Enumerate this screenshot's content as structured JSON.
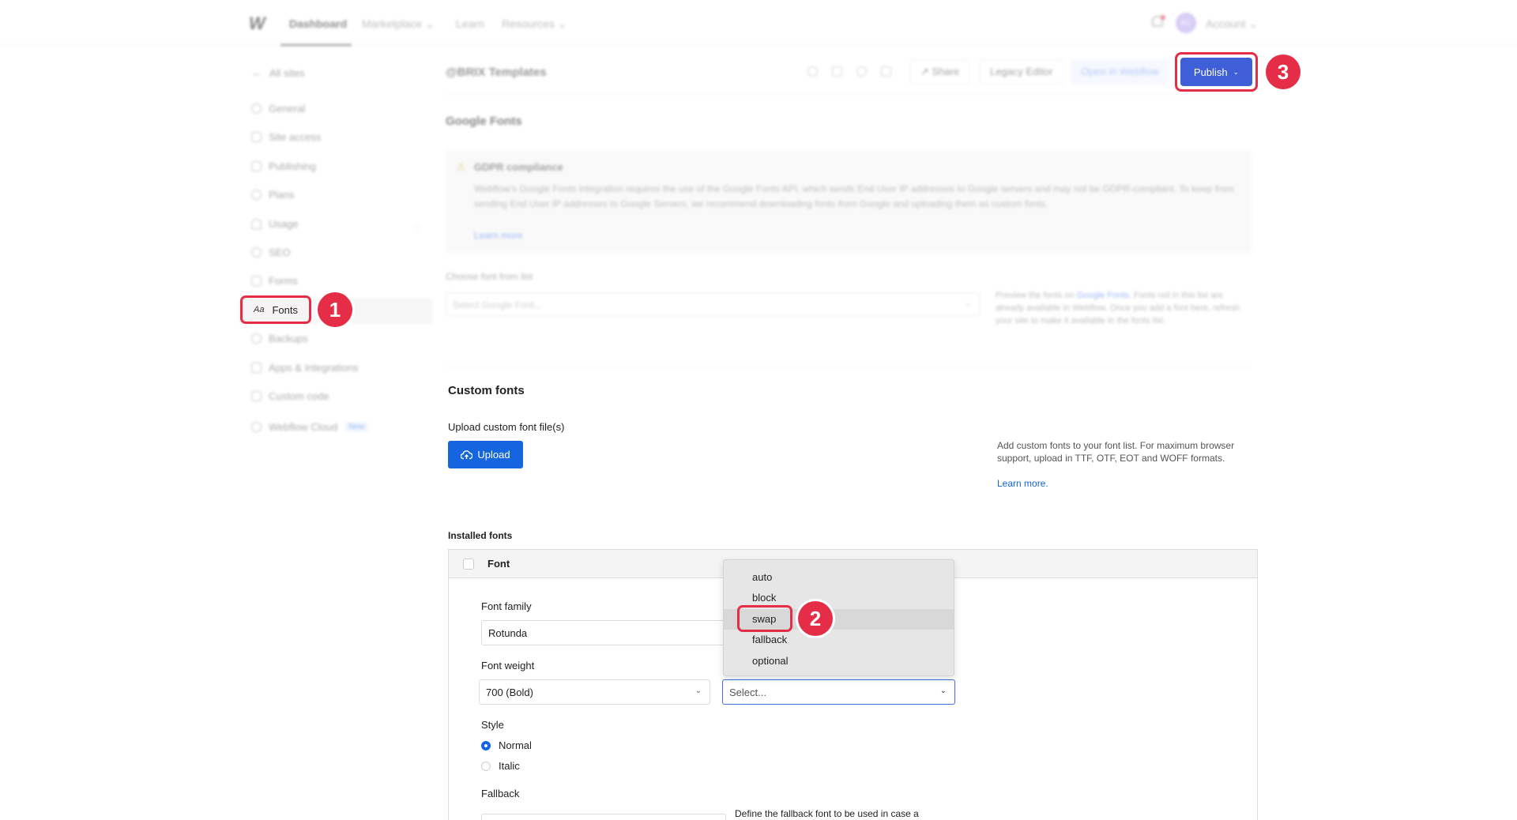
{
  "topnav": {
    "logo": "W",
    "items": [
      "Dashboard",
      "Marketplace",
      "Learn",
      "Resources"
    ],
    "avatar_initials": "RC",
    "account": "Account"
  },
  "sidebar": {
    "back": "All sites",
    "items": [
      "General",
      "Site access",
      "Publishing",
      "Plans",
      "Usage",
      "SEO",
      "Forms",
      "Fonts",
      "Backups",
      "Apps & Integrations",
      "Custom code",
      "Webflow Cloud"
    ],
    "fonts_icon": "Aa",
    "new_badge": "New"
  },
  "header": {
    "site_title": "@BRIX Templates",
    "share": "Share",
    "legacy_editor": "Legacy Editor",
    "open_in_webflow": "Open in Webflow",
    "publish": "Publish"
  },
  "google_fonts": {
    "title": "Google Fonts",
    "gdpr_title": "GDPR compliance",
    "gdpr_text": "Webflow's Google Fonts integration requires the use of the Google Fonts API, which sends End User IP addresses to Google servers and may not be GDPR-compliant. To keep from sending End User IP addresses to Google Servers, we recommend downloading fonts from Google and uploading them as custom fonts.",
    "gdpr_link": "Learn more",
    "choose_label": "Choose font from list",
    "select_placeholder": "Select Google Font...",
    "help_pre": "Preview the fonts on ",
    "help_link": "Google Fonts",
    "help_post": ". Fonts not in this list are already available in Webflow. Once you add a font here, refresh your site to make it available in the fonts list."
  },
  "custom_fonts": {
    "title": "Custom fonts",
    "upload_label": "Upload custom font file(s)",
    "upload_button": "Upload",
    "help": "Add custom fonts to your font list. For maximum browser support, upload in TTF, OTF, EOT and WOFF formats.",
    "learn_more": "Learn more."
  },
  "installed": {
    "title": "Installed fonts",
    "column_font": "Font",
    "font_family_label": "Font family",
    "font_family_value": "Rotunda",
    "font_weight_label": "Font weight",
    "font_weight_value": "700 (Bold)",
    "font_display_placeholder": "Select...",
    "style_label": "Style",
    "style_options": [
      "Normal",
      "Italic"
    ],
    "fallback_label": "Fallback",
    "fallback_help": "Define the fallback font to be used in case a"
  },
  "dropdown": {
    "options": [
      "auto",
      "block",
      "swap",
      "fallback",
      "optional"
    ],
    "highlighted": "swap"
  },
  "markers": [
    "1",
    "2",
    "3"
  ],
  "colors": {
    "publish": "#3f5fd9",
    "upload": "#1565e0",
    "highlight": "#e52d47"
  }
}
